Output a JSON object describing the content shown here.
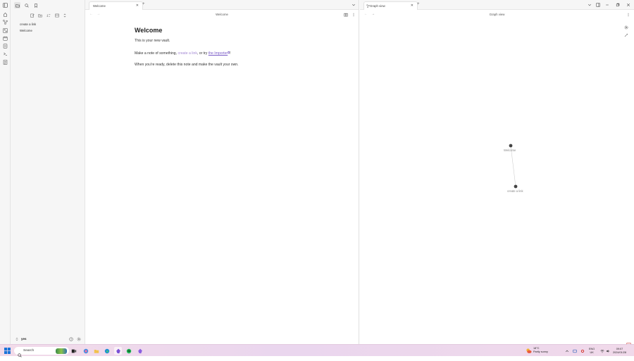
{
  "sidebar": {
    "files": [
      "create a link",
      "Welcome"
    ],
    "vault_name": "yes"
  },
  "left_pane": {
    "tab_title": "Welcome",
    "view_title": "Welcome",
    "note": {
      "heading": "Welcome",
      "p1": "This is your new vault.",
      "p2_prefix": "Make a note of something, ",
      "p2_link_unresolved": "create a link",
      "p2_middle": ", or try ",
      "p2_link_resolved": "the Importer",
      "p2_suffix": "!",
      "p3": "When you're ready, delete this note and make the vault your own."
    }
  },
  "right_pane": {
    "tab_title": "Graph view",
    "view_title": "Graph view",
    "nodes": [
      {
        "label": "Welcome"
      },
      {
        "label": "create a link"
      }
    ]
  },
  "taskbar": {
    "search_label": "Search",
    "weather_temp": "18°C",
    "weather_desc": "Partly sunny",
    "lang_top": "ENG",
    "lang_bottom": "UK",
    "time": "09:07",
    "date": "2024/01/28",
    "notification_count": "1"
  },
  "colors": {
    "accent": "#7a5bc7",
    "unresolved_link": "#a58ad4",
    "ribbon_bg": "#f6f6f6"
  }
}
